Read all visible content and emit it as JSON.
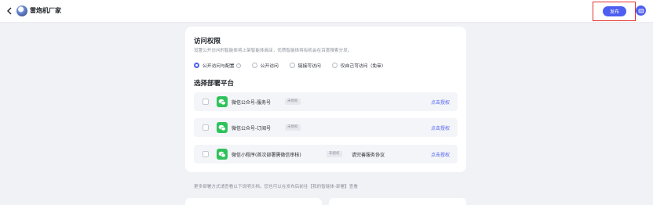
{
  "header": {
    "app_name": "雷炮机厂家",
    "publish_label": "发布"
  },
  "access": {
    "title": "访问权限",
    "description": "设置公开访问的智能体将上架智能体商店，优质智能体将有机会在百度搜索分发。",
    "options": [
      {
        "label": "公开访问与配置",
        "selected": true,
        "has_info": true
      },
      {
        "label": "公开访问",
        "selected": false
      },
      {
        "label": "链接可访问",
        "selected": false
      },
      {
        "label": "仅自己可访问（免审）",
        "selected": false
      }
    ]
  },
  "deploy": {
    "title": "选择部署平台",
    "platforms": [
      {
        "name": "微信公众号-服务号",
        "badge": "未授权",
        "note": "",
        "action": "点击授权"
      },
      {
        "name": "微信公众号-订阅号",
        "badge": "未授权",
        "note": "",
        "action": "点击授权"
      },
      {
        "name": "微信小程序(首次部署需微信审核)",
        "badge": "未授权",
        "note": "请完善服务协议",
        "action": "点击授权"
      }
    ]
  },
  "footer": {
    "note": "更多部署方式请查看以下说明文档，您也可以在发布后前往【我的智能体-部署】查看"
  },
  "colors": {
    "accent": "#4e5ef0",
    "highlight": "#e5322e",
    "wechat_green": "#2fc25b"
  }
}
